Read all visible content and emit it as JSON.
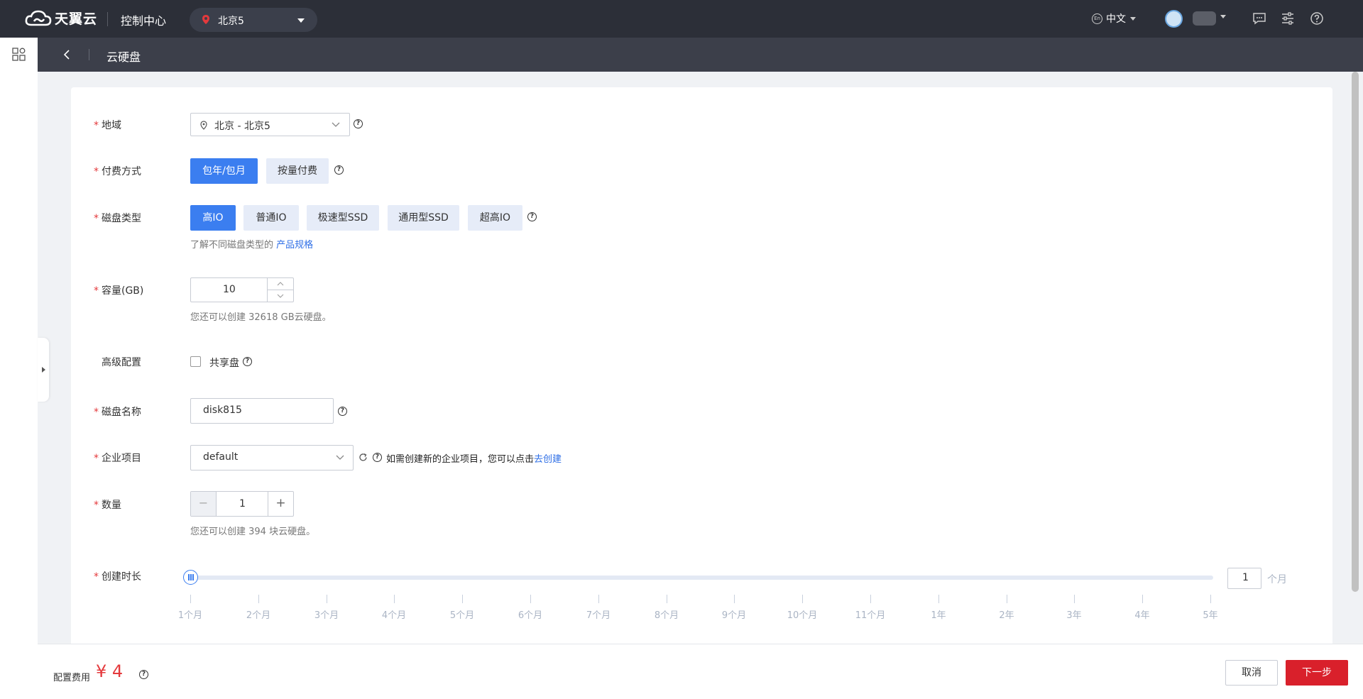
{
  "topbar": {
    "brand": "天翼云",
    "console_title": "控制中心",
    "region": "北京5",
    "language": "中文",
    "lang_icon_text": "En"
  },
  "subheader": {
    "title": "云硬盘"
  },
  "form": {
    "region": {
      "label": "地域",
      "value": "北京 - 北京5"
    },
    "billing": {
      "label": "付费方式",
      "options": [
        "包年/包月",
        "按量付费"
      ],
      "selected": "包年/包月"
    },
    "disk_type": {
      "label": "磁盘类型",
      "options": [
        "高IO",
        "普通IO",
        "极速型SSD",
        "通用型SSD",
        "超高IO"
      ],
      "selected": "高IO",
      "hint_prefix": "了解不同磁盘类型的",
      "hint_link": "产品规格"
    },
    "capacity": {
      "label": "容量(GB)",
      "value": "10",
      "hint": "您还可以创建 32618 GB云硬盘。"
    },
    "advanced": {
      "label": "高级配置",
      "shared_label": "共享盘",
      "shared_checked": false
    },
    "disk_name": {
      "label": "磁盘名称",
      "value": "disk815"
    },
    "project": {
      "label": "企业项目",
      "value": "default",
      "hint_prefix": "如需创建新的企业项目，您可以点击",
      "hint_link": "去创建"
    },
    "quantity": {
      "label": "数量",
      "value": "1",
      "minus": "−",
      "plus": "+",
      "hint": "您还可以创建 394 块云硬盘。"
    },
    "duration": {
      "label": "创建时长",
      "value": "1",
      "unit": "个月",
      "selected_index": 0,
      "ticks": [
        "1个月",
        "2个月",
        "3个月",
        "4个月",
        "5个月",
        "6个月",
        "7个月",
        "8个月",
        "9个月",
        "10个月",
        "11个月",
        "1年",
        "2年",
        "3年",
        "4年",
        "5年"
      ]
    }
  },
  "footer": {
    "fee_label": "配置费用",
    "fee_value": "¥ 4",
    "cancel_label": "取消",
    "next_label": "下一步"
  },
  "colors": {
    "primary": "#3b7ef0",
    "danger": "#d9202b",
    "price": "#e4393c"
  }
}
